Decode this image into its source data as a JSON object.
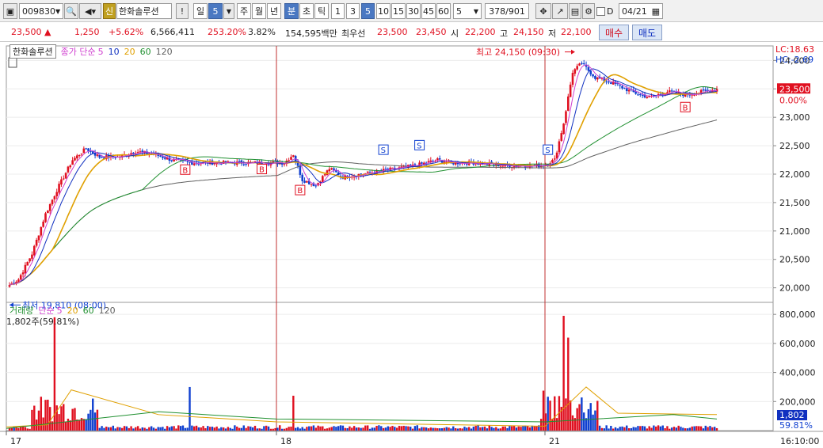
{
  "toolbar": {
    "code": "009830",
    "stock_name": "한화솔루션",
    "badge": "신",
    "period_labels": [
      "일",
      "5",
      "주",
      "월",
      "년",
      "분",
      "초",
      "틱"
    ],
    "interval_labels": [
      "1",
      "3",
      "5",
      "10",
      "15",
      "30",
      "45",
      "60"
    ],
    "count_value": "5",
    "page_counter": "378/901",
    "d_checkbox_label": "D",
    "date_value": "04/21",
    "exclaim": "!"
  },
  "quote": {
    "price": "23,500",
    "change": "1,250",
    "change_pct": "+5.62%",
    "volume": "6,566,411",
    "vol_ratio": "253.20%",
    "turnover": "3.82%",
    "amount": "154,595백만",
    "priority_label": "최우선",
    "ask": "23,500",
    "bid": "23,450",
    "open_label": "시",
    "open": "22,200",
    "high_label": "고",
    "high": "24,150",
    "low_label": "저",
    "low": "22,100",
    "buy_label": "매수",
    "sell_label": "매도"
  },
  "price_pane": {
    "title": "한화솔루션",
    "ma_label": "종가 단순",
    "ma_periods": [
      "5",
      "10",
      "20",
      "60",
      "120"
    ],
    "lc": "LC:18.63",
    "hc": "HC:-2.69",
    "current_price_tag": "23,500",
    "current_pct_tag": "0.00%",
    "high_annot": "최고 24,150 (09:30)",
    "low_annot": "최저 19,810 (08:00)",
    "y_ticks": [
      "24,000",
      "23,500",
      "23,000",
      "22,500",
      "22,000",
      "21,500",
      "21,000",
      "20,500",
      "20,000"
    ]
  },
  "volume_pane": {
    "title": "거래량",
    "ma_label": "단순",
    "ma_periods": [
      "5",
      "20",
      "60",
      "120"
    ],
    "current": "1,802주(59.81%)",
    "volume_tag": "1,802",
    "volume_pct_tag": "59.81%",
    "y_ticks": [
      "800,000",
      "600,000",
      "400,000",
      "200,000"
    ]
  },
  "x_axis": {
    "day_labels": [
      "17",
      "18",
      "21"
    ],
    "time_label": "16:10:00"
  },
  "colors": {
    "up": "#e01020",
    "down": "#1040d0",
    "ma5": "#d040d0",
    "ma10": "#1030c0",
    "ma20": "#e0a000",
    "ma60": "#209030",
    "ma120": "#606060",
    "selected": "#4a78c2"
  },
  "chart_data": {
    "type": "line",
    "x": [
      "17",
      "18",
      "21"
    ],
    "series": [
      {
        "name": "종가 단순 5",
        "values": [
          22200,
          22200,
          23400
        ]
      },
      {
        "name": "120",
        "values": [
          20100,
          21900,
          23050
        ]
      }
    ],
    "ylim": [
      19800,
      24200
    ],
    "volume_ylim": [
      0,
      850000
    ],
    "signals": [
      "B",
      "B",
      "B",
      "S",
      "S",
      "S",
      "B"
    ]
  }
}
